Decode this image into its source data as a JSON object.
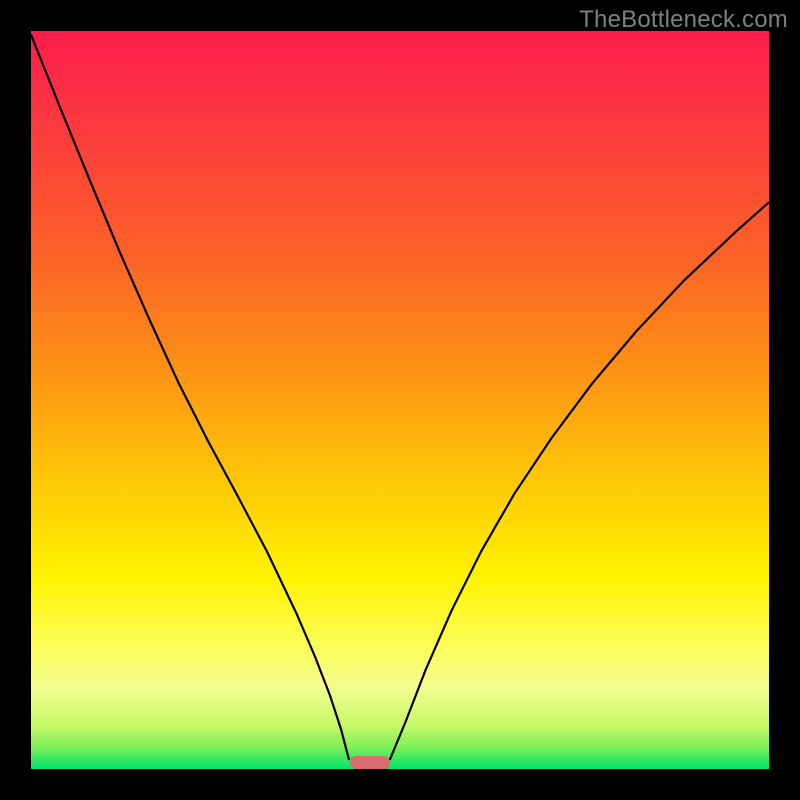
{
  "watermark": "TheBottleneck.com",
  "chart_data": {
    "type": "line",
    "title": "",
    "xlabel": "",
    "ylabel": "",
    "xlim": [
      0,
      100
    ],
    "ylim": [
      0,
      100
    ],
    "grid": false,
    "legend": false,
    "background_gradient": {
      "orientation": "vertical",
      "stops": [
        {
          "pos": 0.0,
          "color": "#fb1d4d"
        },
        {
          "pos": 0.13,
          "color": "#fb3a3e"
        },
        {
          "pos": 0.3,
          "color": "#fc6128"
        },
        {
          "pos": 0.45,
          "color": "#fd8f16"
        },
        {
          "pos": 0.6,
          "color": "#fec408"
        },
        {
          "pos": 0.74,
          "color": "#fff300"
        },
        {
          "pos": 0.83,
          "color": "#fdfd55"
        },
        {
          "pos": 0.89,
          "color": "#f3fd90"
        },
        {
          "pos": 0.94,
          "color": "#c8fa68"
        },
        {
          "pos": 0.97,
          "color": "#7ff05a"
        },
        {
          "pos": 1.0,
          "color": "#00e56b"
        }
      ]
    },
    "series": [
      {
        "name": "left-curve",
        "x": [
          0.0,
          4.0,
          8.0,
          12.0,
          16.0,
          20.0,
          24.0,
          28.0,
          32.0,
          36.0,
          38.5,
          40.5,
          42.0,
          43.1
        ],
        "y": [
          99.5,
          89.5,
          79.7,
          70.1,
          61.0,
          52.3,
          44.4,
          37.0,
          29.4,
          21.0,
          15.2,
          10.0,
          5.4,
          1.2
        ]
      },
      {
        "name": "right-curve",
        "x": [
          48.6,
          50.8,
          53.5,
          57.0,
          61.0,
          65.5,
          70.5,
          76.0,
          82.0,
          88.5,
          95.5,
          100.0
        ],
        "y": [
          1.2,
          6.5,
          13.5,
          21.5,
          29.5,
          37.3,
          44.8,
          52.2,
          59.3,
          66.2,
          72.8,
          76.8
        ]
      }
    ],
    "marker": {
      "name": "optimum-marker",
      "color": "#d96c6e",
      "x_center": 45.9,
      "y_center": 0.9,
      "width_pct": 5.4,
      "height_pct": 1.8
    }
  }
}
